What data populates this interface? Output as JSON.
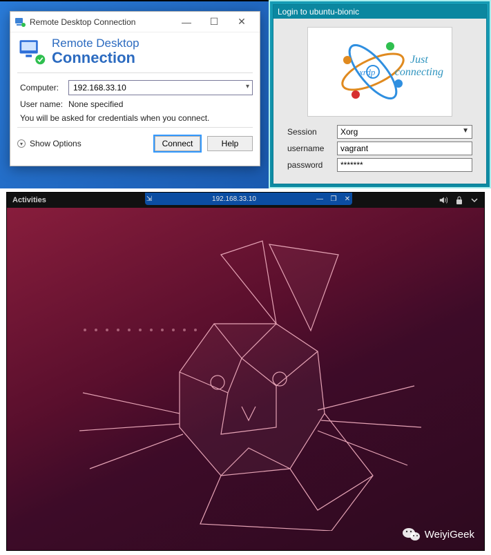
{
  "rdc": {
    "title": "Remote Desktop Connection",
    "banner_line1": "Remote Desktop",
    "banner_line2": "Connection",
    "computer_label": "Computer:",
    "computer_value": "192.168.33.10",
    "username_label": "User name:",
    "username_value": "None specified",
    "hint": "You will be asked for credentials when you connect.",
    "show_options": "Show Options",
    "connect": "Connect",
    "help": "Help",
    "win_minimize": "—",
    "win_maximize": "☐",
    "win_close": "✕"
  },
  "xrdp": {
    "title": "Login to ubuntu-bionic",
    "logo_text": "xrdp",
    "tagline1": "Just",
    "tagline2": "connecting",
    "session_label": "Session",
    "session_value": "Xorg",
    "username_label": "username",
    "username_value": "vagrant",
    "password_label": "password",
    "password_value": "*******"
  },
  "ubuntu": {
    "activities": "Activities",
    "remote_ip": "192.168.33.10",
    "pin": "⇲",
    "min": "—",
    "restore": "❐",
    "close": "✕",
    "speaker_icon": "volume-icon",
    "lock_icon": "lock-icon",
    "power_icon": "power-icon"
  },
  "watermark": {
    "text": "WeiyiGeek"
  }
}
